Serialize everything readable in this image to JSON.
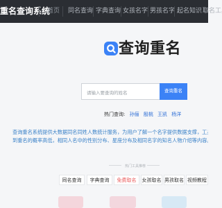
{
  "header": {
    "brand": "重名查询系统",
    "nav": [
      "首页",
      "同名查询",
      "字典查询",
      "女孩名字",
      "男孩名字",
      "起名知识",
      "取名工具"
    ]
  },
  "logo": {
    "text": "查询重名",
    "icon": "magnifier-q-icon"
  },
  "search": {
    "placeholder": "请输入要查询的姓名",
    "value": "",
    "button": "查询重名"
  },
  "hot": {
    "label": "热门查询:",
    "items": [
      "孙俪",
      "殷桃",
      "王凯",
      "杨洋"
    ]
  },
  "intro": {
    "lines": [
      "查询重名系统提供大数据同名同姓人数统计服务，为用户了解一个名字提供数据支撑，工具可以查",
      "到重名的概率高低，相同人名中的性别分布、星座分布及相同名字的知名人物介绍等内容。"
    ]
  },
  "tools": {
    "title": "热门工具推荐",
    "items": [
      "同名查询",
      "字典查询",
      "免费取名",
      "女孩取名",
      "男孩取名",
      "视频教程"
    ],
    "active_index": 2
  },
  "colors": {
    "topbar": "#2b2e33",
    "accent": "#3b82f6",
    "link": "#2f6fd6",
    "active_tool": "#ea5a5a"
  }
}
